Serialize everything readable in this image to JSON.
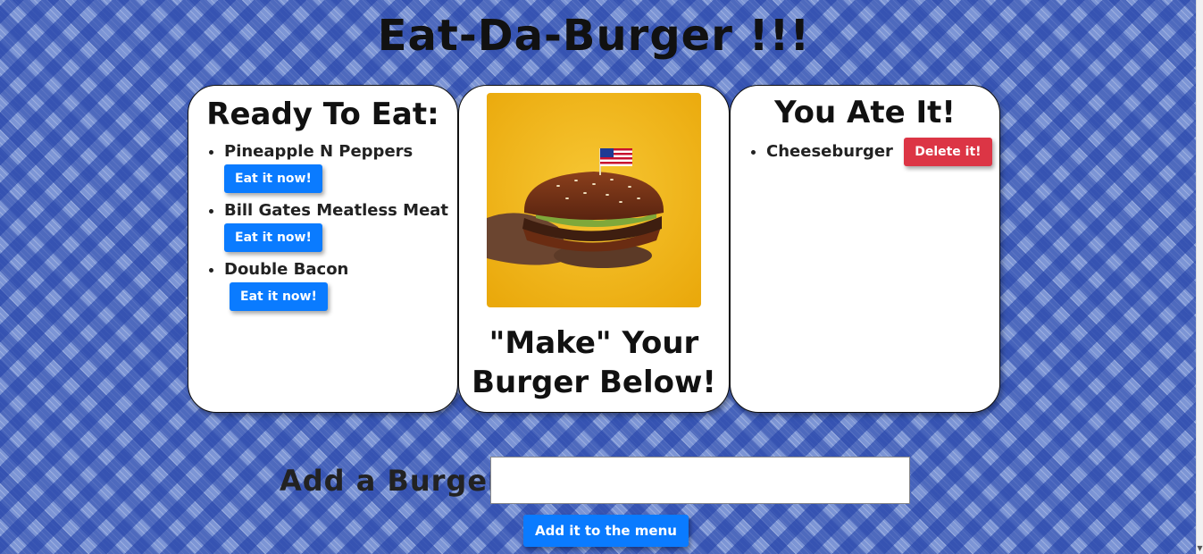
{
  "page": {
    "title": "Eat-Da-Burger !!!"
  },
  "ready": {
    "heading": "Ready To Eat:",
    "items": [
      {
        "name": "Pineapple N Peppers",
        "button": "Eat it now!"
      },
      {
        "name": "Bill Gates Meatless Meat",
        "button": "Eat it now!"
      },
      {
        "name": "Double Bacon",
        "button": "Eat it now!"
      }
    ]
  },
  "middle": {
    "tagline": "\"Make\" Your Burger Below!"
  },
  "eaten": {
    "heading": "You Ate It!",
    "items": [
      {
        "name": "Cheeseburger",
        "button": "Delete it!"
      }
    ]
  },
  "form": {
    "label": "Add a Burger:",
    "input_value": "",
    "input_placeholder": "",
    "submit_label": "Add it to the menu"
  },
  "colors": {
    "primary_button": "#0a7bff",
    "danger_button": "#dc3545",
    "photo_background": "#f2b81a"
  },
  "icons": {
    "scroll_down": "scroll-down-arrow-icon",
    "flag": "american-flag-icon"
  }
}
